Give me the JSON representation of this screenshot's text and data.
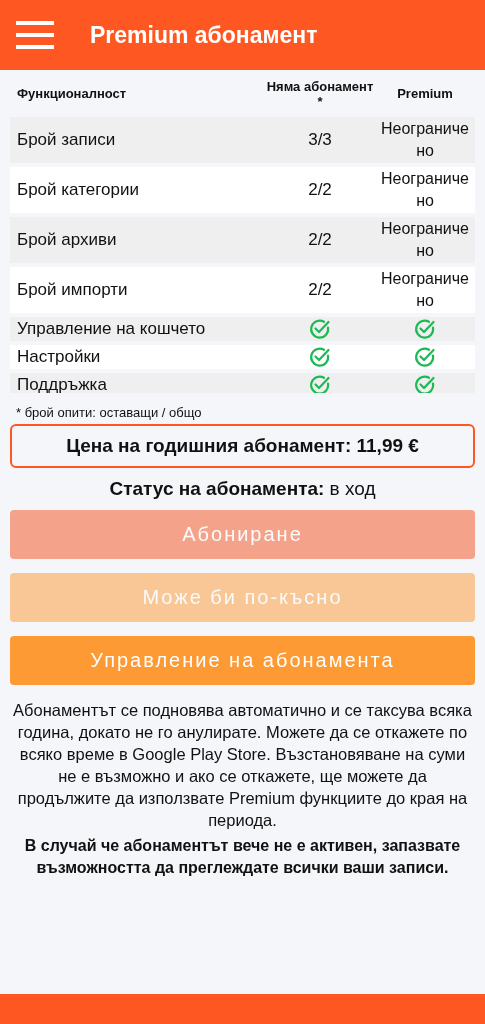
{
  "app_bar": {
    "title": "Premium абонамент"
  },
  "table": {
    "columns": [
      "Функционалност",
      "Няма абонамент *",
      "Premium"
    ],
    "rows": [
      {
        "feature": "Брой записи",
        "no_subscription": {
          "kind": "text",
          "text": "3/3"
        },
        "premium": {
          "kind": "text",
          "text": "Неограниче но"
        }
      },
      {
        "feature": "Брой категории",
        "no_subscription": {
          "kind": "text",
          "text": "2/2"
        },
        "premium": {
          "kind": "text",
          "text": "Неограниче но"
        }
      },
      {
        "feature": "Брой архиви",
        "no_subscription": {
          "kind": "text",
          "text": "2/2"
        },
        "premium": {
          "kind": "text",
          "text": "Неограниче но"
        }
      },
      {
        "feature": "Брой импорти",
        "no_subscription": {
          "kind": "text",
          "text": "2/2"
        },
        "premium": {
          "kind": "text",
          "text": "Неограниче но"
        }
      },
      {
        "feature": "Управление на кошчето",
        "no_subscription": {
          "kind": "check",
          "checked": true
        },
        "premium": {
          "kind": "check",
          "checked": true
        }
      },
      {
        "feature": "Настройки",
        "no_subscription": {
          "kind": "check",
          "checked": true
        },
        "premium": {
          "kind": "check",
          "checked": true
        }
      },
      {
        "feature": "Поддръжка",
        "no_subscription": {
          "kind": "check",
          "checked": true
        },
        "premium": {
          "kind": "check",
          "checked": true
        }
      }
    ]
  },
  "footnote": "* брой опити: оставащи / общо",
  "price": "Цена на годишния абонамент: 11,99 €",
  "status": "**Статус на абонамента:** в ход",
  "buttons": [
    {
      "label": "Абониране",
      "kind": "primary",
      "disabled": true
    },
    {
      "label": "Може би по-късно",
      "kind": "secondary",
      "disabled": true
    },
    {
      "label": "Управление на абонамента",
      "kind": "secondary",
      "disabled": false
    }
  ],
  "notice": "Абонаментът се подновява автоматично и се таксува всяка година, докато не го анулирате. Можете да се откажете по всяко време в Google Play Store. Възстановяване на суми не е възможно и ако се откажете, ще можете да продължите да използвате Premium функциите до края на периода.",
  "notice_bold": "В случай че абонаментът вече не е активен, запазвате възможността да преглеждате всички ваши записи."
}
